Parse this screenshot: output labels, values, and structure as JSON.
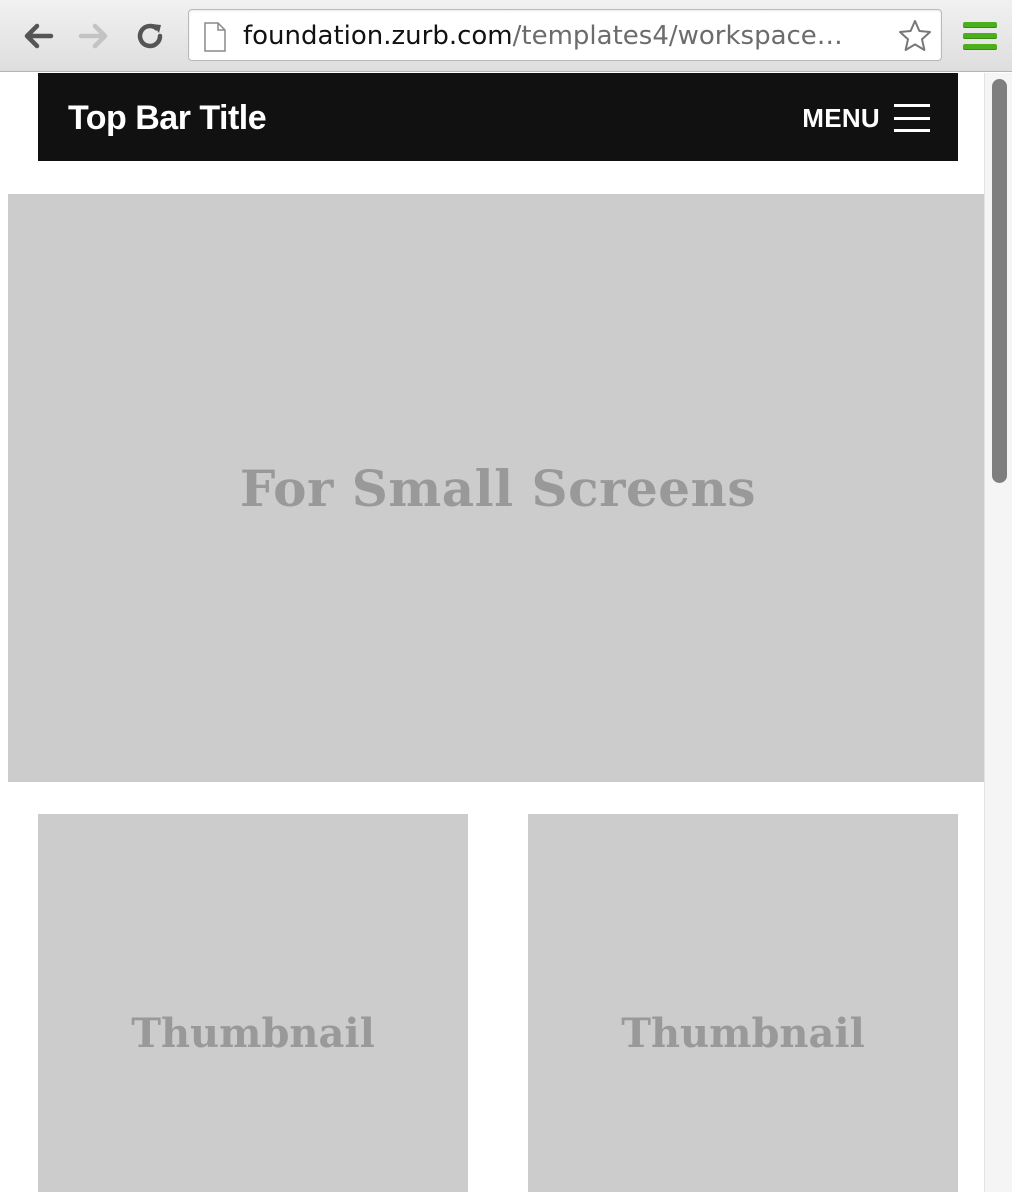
{
  "browser": {
    "url_host": "foundation.zurb.com",
    "url_path": "/templates4/workspace…",
    "back_icon": "back-arrow-icon",
    "forward_icon": "forward-arrow-icon",
    "reload_icon": "reload-icon",
    "page_icon": "document-icon",
    "bookmark_icon": "star-icon",
    "menu_icon": "hamburger-menu-icon",
    "menu_color": "#4caf1c"
  },
  "topbar": {
    "title": "Top Bar Title",
    "menu_label": "MENU",
    "background": "#111111"
  },
  "hero": {
    "text": "For Small Screens"
  },
  "thumbnails": [
    {
      "text": "Thumbnail"
    },
    {
      "text": "Thumbnail"
    }
  ],
  "colors": {
    "placeholder_bg": "#cccccc",
    "placeholder_text": "#999999"
  }
}
